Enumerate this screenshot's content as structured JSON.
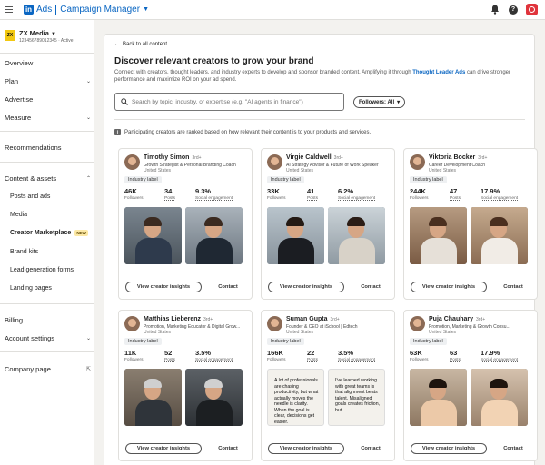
{
  "header": {
    "logo_letters": "in",
    "product": "Ads",
    "app_name": "Campaign Manager",
    "help_label": "?"
  },
  "account": {
    "logo_text": "ZX",
    "name": "ZX Media",
    "sub": "123456789012345 · Active"
  },
  "sidebar": {
    "items": [
      {
        "label": "Overview"
      },
      {
        "label": "Plan"
      },
      {
        "label": "Advertise"
      },
      {
        "label": "Measure"
      },
      {
        "label": "Recommendations"
      },
      {
        "label": "Content & assets"
      },
      {
        "label": "Posts and ads"
      },
      {
        "label": "Media"
      },
      {
        "label": "Creator Marketplace",
        "badge": "NEW"
      },
      {
        "label": "Brand kits"
      },
      {
        "label": "Lead generation forms"
      },
      {
        "label": "Landing pages"
      },
      {
        "label": "Billing"
      },
      {
        "label": "Account settings"
      },
      {
        "label": "Company page"
      }
    ]
  },
  "main": {
    "back_label": "Back to all content",
    "title": "Discover relevant creators to grow your brand",
    "desc_before": "Connect with creators, thought leaders, and industry experts to develop and sponsor branded content. Amplifying it through ",
    "desc_link": "Thought Leader Ads",
    "desc_after": " can drive stronger performance and maximize ROI on your ad spend.",
    "search_placeholder": "Search by topic, industry, or expertise (e.g. \"AI agents in finance\")",
    "filter_label": "Followers: All",
    "info_text": "Participating creators are ranked based on how relevant their content is to your products and services.",
    "industry_label": "Industry label",
    "followers_label": "Followers",
    "posts_label": "Posts",
    "engagement_label": "Social engagement",
    "insights_button": "View creator insights",
    "contact_button": "Contact"
  },
  "creators": [
    {
      "name": "Timothy Simon",
      "degree": "3rd+",
      "title": "Growth Strategist & Personal Branding Coach",
      "location": "United States",
      "followers": "46K",
      "posts": "34",
      "engagement": "9.3%"
    },
    {
      "name": "Virgie Caldwell",
      "degree": "3rd+",
      "title": "AI Strategy Advisor & Future of Work Speaker",
      "location": "United States",
      "followers": "33K",
      "posts": "41",
      "engagement": "6.2%"
    },
    {
      "name": "Viktoria Bocker",
      "degree": "3rd+",
      "title": "Career Development Coach",
      "location": "United States",
      "followers": "244K",
      "posts": "47",
      "engagement": "17.9%"
    },
    {
      "name": "Matthias Lieberenz",
      "degree": "3rd+",
      "title": "Promotion, Marketing Educator & Digital Grow...",
      "location": "United States",
      "followers": "11K",
      "posts": "52",
      "engagement": "3.5%"
    },
    {
      "name": "Suman Gupta",
      "degree": "3rd+",
      "title": "Founder & CEO at iSchool | Edtech",
      "location": "United States",
      "followers": "166K",
      "posts": "22",
      "engagement": "3.5%",
      "quotes": [
        "A lot of professionals are chasing productivity, but what actually moves the needle is clarity. When the goal is clear, decisions get easier.",
        "I've learned working with great teams is that alignment beats talent. Misaligned goals creates friction, but..."
      ]
    },
    {
      "name": "Puja Chauhary",
      "degree": "3rd+",
      "title": "Promotion, Marketing & Growth Consu...",
      "location": "United States",
      "followers": "63K",
      "posts": "63",
      "engagement": "17.9%"
    }
  ]
}
